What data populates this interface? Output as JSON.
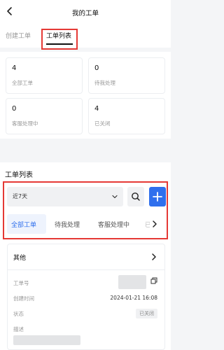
{
  "header": {
    "title": "我的工单",
    "back_icon": "chevron-left-icon"
  },
  "tabs": [
    {
      "label": "创建工单",
      "active": false
    },
    {
      "label": "工单列表",
      "active": true
    }
  ],
  "summary": {
    "cards": [
      {
        "count": "4",
        "label": "全部工单"
      },
      {
        "count": "0",
        "label": "待我处理"
      },
      {
        "count": "0",
        "label": "客服处理中"
      },
      {
        "count": "4",
        "label": "已关闭"
      }
    ]
  },
  "list": {
    "title": "工单列表",
    "date_filter": "近7天",
    "search_icon": "search-icon",
    "add_icon": "plus-icon",
    "accent_color": "#2f6fed",
    "filter_tabs": [
      {
        "label": "全部工单",
        "active": true
      },
      {
        "label": "待我处理",
        "active": false
      },
      {
        "label": "客服处理中",
        "active": false
      },
      {
        "label": "已",
        "active": false
      }
    ],
    "item": {
      "title": "其他",
      "fields": {
        "ticket_no_label": "工单号",
        "created_label": "创建时间",
        "created_value": "2024-01-21 16:08",
        "status_label": "状态",
        "status_value": "已关闭",
        "desc_label": "描述"
      }
    }
  },
  "highlight_color": "#e53935"
}
